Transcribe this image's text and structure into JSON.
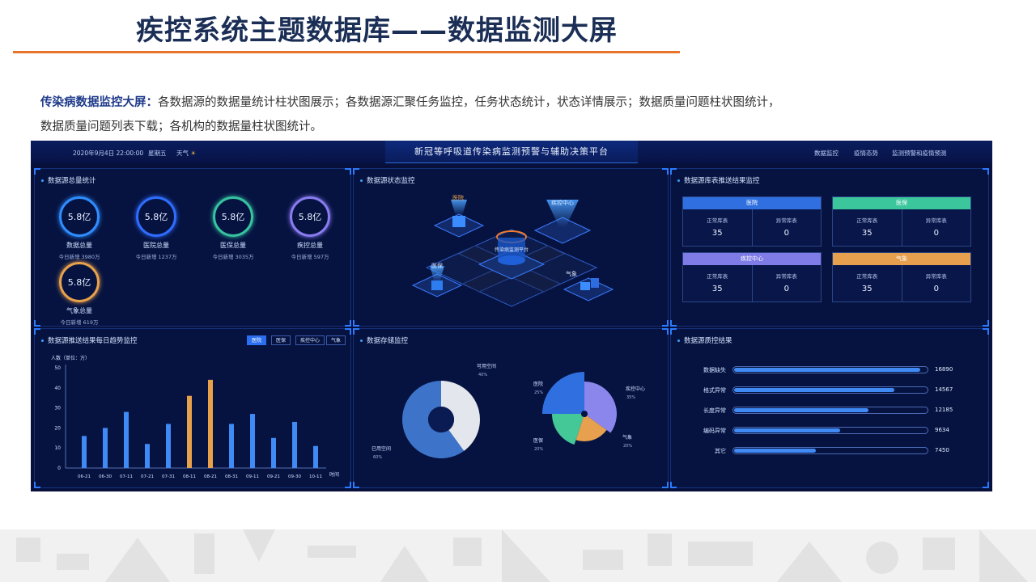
{
  "slide": {
    "title": "疾控系统主题数据库——数据监测大屏",
    "desc_bold": "传染病数据监控大屏：",
    "desc_line1": "各数据源的数据量统计柱状图展示；各数据源汇聚任务监控，任务状态统计，状态详情展示；数据质量问题柱状图统计，",
    "desc_line2": "数据质量问题列表下载；各机构的数据量柱状图统计。",
    "title_color": "#1b2e55",
    "rule_color": "#e8732a"
  },
  "dashboard": {
    "datetime": "2020年9月4日 22:00:00",
    "weekday": "星期五",
    "weather_label": "天气",
    "weather_icon": "sun-icon",
    "title": "新冠等呼吸道传染病监测预警与辅助决策平台",
    "nav": [
      "数据监控",
      "疫情态势",
      "监测预警和疫情预测"
    ],
    "panels": {
      "totals": {
        "title": "数据源总量统计",
        "items": [
          {
            "value": "5.8亿",
            "label": "数据总量",
            "sub": "今日新增   3980万",
            "color": "#2f8dff"
          },
          {
            "value": "5.8亿",
            "label": "医院总量",
            "sub": "今日新增   1237万",
            "color": "#2f6dff"
          },
          {
            "value": "5.8亿",
            "label": "医保总量",
            "sub": "今日新增   3035万",
            "color": "#36c3a0"
          },
          {
            "value": "5.8亿",
            "label": "疾控总量",
            "sub": "今日新增   597万",
            "color": "#8a7cf0"
          },
          {
            "value": "5.8亿",
            "label": "气象总量",
            "sub": "今日新增   619万",
            "color": "#e8a14b"
          }
        ]
      },
      "status": {
        "title": "数据源状态监控",
        "labels": {
          "hospital": "医院",
          "cdc": "疾控中心",
          "insurance": "医保",
          "weather": "气象",
          "center": "传染病监测平台"
        }
      },
      "push": {
        "title": "数据源库表推送结果监控",
        "col_normal": "正常库表",
        "col_abnormal": "异常库表",
        "cards": [
          {
            "name": "医院",
            "normal": "35",
            "abnormal": "0",
            "color": "#2f6fe0"
          },
          {
            "name": "医保",
            "normal": "35",
            "abnormal": "0",
            "color": "#3cc69c"
          },
          {
            "name": "疾控中心",
            "normal": "35",
            "abnormal": "0",
            "color": "#7f7ce8"
          },
          {
            "name": "气象",
            "normal": "35",
            "abnormal": "0",
            "color": "#e6a04e"
          }
        ]
      },
      "trend": {
        "title": "数据源推送结果每日趋势监控",
        "tabs": [
          "医院",
          "医保",
          "疾控中心",
          "气象"
        ],
        "active_tab": 0
      },
      "storage": {
        "title": "数据存储监控"
      },
      "quality": {
        "title": "数据源质控结果",
        "max": 17500,
        "rows": [
          {
            "label": "数据缺失",
            "value": 16890
          },
          {
            "label": "格式异常",
            "value": 14567
          },
          {
            "label": "长度异常",
            "value": 12185
          },
          {
            "label": "编码异常",
            "value": 9634
          },
          {
            "label": "其它",
            "value": 7450
          }
        ]
      }
    }
  },
  "chart_data": [
    {
      "type": "bar",
      "ylabel": "人数（单位：万）",
      "xlabel": "时间",
      "ylim": [
        0,
        50
      ],
      "yticks": [
        0,
        10,
        20,
        30,
        40,
        50
      ],
      "categories": [
        "06-21",
        "06-30",
        "07-11",
        "07-21",
        "07-31",
        "08-11",
        "08-21",
        "08-31",
        "09-11",
        "09-21",
        "09-30",
        "10-11"
      ],
      "values": [
        16,
        20,
        28,
        12,
        22,
        36,
        44,
        22,
        27,
        15,
        23,
        11
      ],
      "highlight": [
        5,
        6
      ],
      "colors": {
        "normal": "#3f8af5",
        "highlight": "#e8a14b"
      }
    },
    {
      "type": "pie",
      "variant": "donut",
      "slices": [
        {
          "label": "可用空间",
          "pct": "40%",
          "value": 40,
          "color": "#e3e6ec"
        },
        {
          "label": "已用空间",
          "pct": "60%",
          "value": 60,
          "color": "#3d74c9"
        }
      ]
    },
    {
      "type": "pie",
      "variant": "rose",
      "slices": [
        {
          "label": "医院",
          "pct": "25%",
          "value": 25,
          "color": "#2f6fe0"
        },
        {
          "label": "疾控中心",
          "pct": "35%",
          "value": 35,
          "color": "#8a86ec"
        },
        {
          "label": "气象",
          "pct": "20%",
          "value": 20,
          "color": "#e6a04e"
        },
        {
          "label": "医保",
          "pct": "20%",
          "value": 20,
          "color": "#45c897"
        }
      ]
    }
  ]
}
